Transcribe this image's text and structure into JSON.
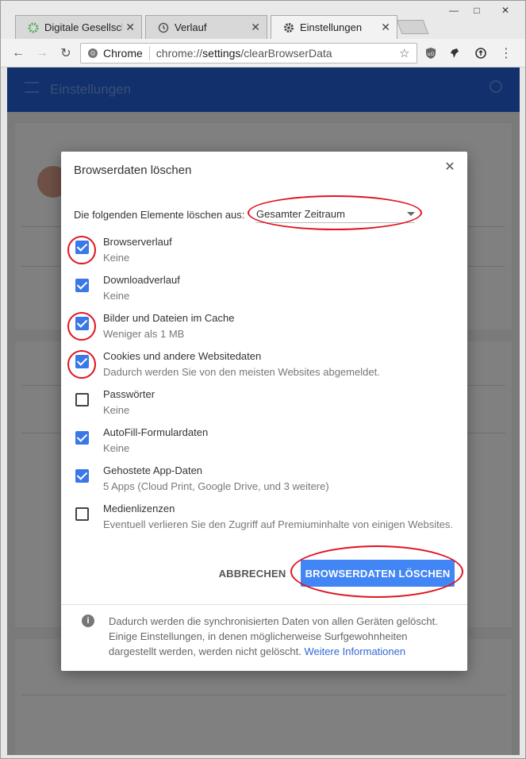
{
  "window": {
    "controls": {
      "minimize": "—",
      "maximize": "□",
      "close": "✕"
    }
  },
  "tabs": [
    {
      "title": "Digitale Gesellscha",
      "icon": "green-gear-icon"
    },
    {
      "title": "Verlauf",
      "icon": "history-icon"
    },
    {
      "title": "Einstellungen",
      "icon": "settings-gear-icon",
      "active": true
    }
  ],
  "toolbar": {
    "chip_label": "Chrome",
    "url_scheme": "chrome://",
    "url_host": "settings",
    "url_path": "/clearBrowserData"
  },
  "page": {
    "header_title": "Einstellungen"
  },
  "dialog": {
    "title": "Browserdaten löschen",
    "close": "✕",
    "range_label": "Die folgenden Elemente löschen aus:",
    "range_value": "Gesamter Zeitraum",
    "items": [
      {
        "title": "Browserverlauf",
        "sub": "Keine",
        "checked": true
      },
      {
        "title": "Downloadverlauf",
        "sub": "Keine",
        "checked": true
      },
      {
        "title": "Bilder und Dateien im Cache",
        "sub": "Weniger als 1 MB",
        "checked": true
      },
      {
        "title": "Cookies und andere Websitedaten",
        "sub": "Dadurch werden Sie von den meisten Websites abgemeldet.",
        "checked": true
      },
      {
        "title": "Passwörter",
        "sub": "Keine",
        "checked": false
      },
      {
        "title": "AutoFill-Formulardaten",
        "sub": "Keine",
        "checked": true
      },
      {
        "title": "Gehostete App-Daten",
        "sub": "5 Apps (Cloud Print, Google Drive, und 3 weitere)",
        "checked": true
      },
      {
        "title": "Medienlizenzen",
        "sub": "Eventuell verlieren Sie den Zugriff auf Premiuminhalte von einigen Websites.",
        "checked": false
      }
    ],
    "cancel_label": "ABBRECHEN",
    "clear_label": "BROWSERDATEN LÖSCHEN",
    "info_text": "Dadurch werden die synchronisierten Daten von allen Geräten gelöscht. Einige Einstellungen, in denen möglicherweise Surfgewohnheiten dargestellt werden, werden nicht gelöscht.",
    "info_link": "Weitere Informationen"
  },
  "colors": {
    "accent": "#4285f4",
    "checkbox": "#3b78e7",
    "annotation": "#e0141e",
    "header": "#12306b"
  }
}
